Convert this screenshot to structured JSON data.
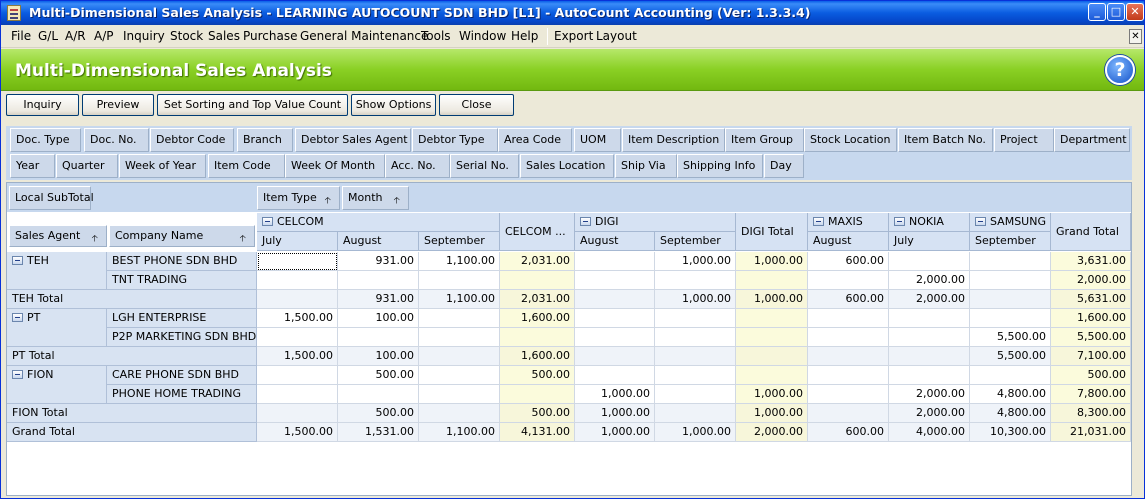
{
  "window": {
    "title": "Multi-Dimensional Sales Analysis - LEARNING AUTOCOUNT SDN BHD [L1] - AutoCount Accounting (Ver: 1.3.3.4)",
    "controls": [
      "_",
      "□",
      "✕"
    ]
  },
  "menu": [
    "File",
    "G/L",
    "A/R",
    "A/P",
    "Inquiry",
    "Stock",
    "Sales",
    "Purchase",
    "General Maintenance",
    "Tools",
    "Window",
    "Help",
    "Export",
    "Layout"
  ],
  "mdi_close": "✕",
  "banner": {
    "title": "Multi-Dimensional Sales Analysis",
    "help": "?"
  },
  "toolbar": [
    "Inquiry",
    "Preview",
    "Set Sorting and Top Value Count",
    "Show Options",
    "Close"
  ],
  "field_chips": {
    "row1": [
      "Doc. Type",
      "Doc. No.",
      "Debtor Code",
      "Branch",
      "Debtor Sales Agent",
      "Debtor Type",
      "Area Code",
      "UOM",
      "Item Description",
      "Item Group",
      "Stock Location",
      "Item Batch No.",
      "Project",
      "Department"
    ],
    "row2": [
      "Year",
      "Quarter",
      "Week of Year",
      "Item Code",
      "Week Of Month",
      "Acc. No.",
      "Serial No.",
      "Sales Location",
      "Ship Via",
      "Shipping Info",
      "Day"
    ]
  },
  "grid": {
    "data_area_label": "Local SubTotal",
    "column_fields": [
      "Item Type",
      "Month"
    ],
    "row_fields": [
      "Sales Agent",
      "Company Name"
    ],
    "sort_arrow": "🡡",
    "column_groups": [
      "CELCOM",
      "DIGI",
      "MAXIS",
      "NOKIA",
      "SAMSUNG"
    ],
    "group_totals": [
      "CELCOM ...",
      "DIGI Total"
    ],
    "grand_total_label": "Grand Total",
    "months": [
      "July",
      "August",
      "September",
      "August",
      "September",
      "August",
      "July",
      "September"
    ],
    "rows": [
      {
        "agent": "TEH",
        "company": "BEST PHONE SDN BHD",
        "values": [
          "",
          "931.00",
          "1,100.00",
          "2,031.00",
          "",
          "1,000.00",
          "1,000.00",
          "600.00",
          "",
          "",
          "3,631.00"
        ]
      },
      {
        "agent": "",
        "company": "TNT TRADING",
        "values": [
          "",
          "",
          "",
          "",
          "",
          "",
          "",
          "",
          "2,000.00",
          "",
          "2,000.00"
        ]
      },
      {
        "agent": "TEH Total",
        "company": "",
        "values": [
          "",
          "931.00",
          "1,100.00",
          "2,031.00",
          "",
          "1,000.00",
          "1,000.00",
          "600.00",
          "2,000.00",
          "",
          "5,631.00"
        ]
      },
      {
        "agent": "PT",
        "company": "LGH ENTERPRISE",
        "values": [
          "1,500.00",
          "100.00",
          "",
          "1,600.00",
          "",
          "",
          "",
          "",
          "",
          "",
          "1,600.00"
        ]
      },
      {
        "agent": "",
        "company": "P2P MARKETING SDN BHD",
        "values": [
          "",
          "",
          "",
          "",
          "",
          "",
          "",
          "",
          "",
          "5,500.00",
          "5,500.00"
        ]
      },
      {
        "agent": "PT Total",
        "company": "",
        "values": [
          "1,500.00",
          "100.00",
          "",
          "1,600.00",
          "",
          "",
          "",
          "",
          "",
          "5,500.00",
          "7,100.00"
        ]
      },
      {
        "agent": "FION",
        "company": "CARE PHONE SDN BHD",
        "values": [
          "",
          "500.00",
          "",
          "500.00",
          "",
          "",
          "",
          "",
          "",
          "",
          "500.00"
        ]
      },
      {
        "agent": "",
        "company": "PHONE HOME TRADING",
        "values": [
          "",
          "",
          "",
          "",
          "1,000.00",
          "",
          "1,000.00",
          "",
          "2,000.00",
          "4,800.00",
          "7,800.00"
        ]
      },
      {
        "agent": "FION Total",
        "company": "",
        "values": [
          "",
          "500.00",
          "",
          "500.00",
          "1,000.00",
          "",
          "1,000.00",
          "",
          "2,000.00",
          "4,800.00",
          "8,300.00"
        ]
      },
      {
        "agent": "Grand Total",
        "company": "",
        "values": [
          "1,500.00",
          "1,531.00",
          "1,100.00",
          "4,131.00",
          "1,000.00",
          "1,000.00",
          "2,000.00",
          "600.00",
          "4,000.00",
          "10,300.00",
          "21,031.00"
        ]
      }
    ]
  }
}
